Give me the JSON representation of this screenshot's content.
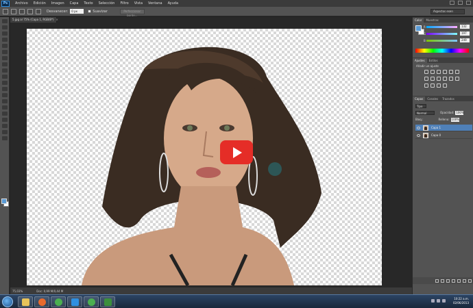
{
  "app": {
    "logo": "Ps"
  },
  "menu": [
    "Archivo",
    "Edición",
    "Imagen",
    "Capa",
    "Texto",
    "Selección",
    "Filtro",
    "Vista",
    "Ventana",
    "Ayuda"
  ],
  "options": {
    "feather_label": "Desvanecer:",
    "feather_value": "0 px",
    "antialias_label": "Suavizar",
    "refine_button": "Perfeccionar borde...",
    "workspace": "Aspectos esen"
  },
  "document": {
    "tab_title": "5.jpg al 75% (Capa 1, RGB/8*)",
    "zoom": "75,03%",
    "doc_size": "Doc: 0,99 M/0,44 M"
  },
  "panels": {
    "color": {
      "tabs": [
        "Color",
        "Muestras"
      ],
      "channels": [
        {
          "label": "R",
          "value": "132",
          "gradient": "linear-gradient(90deg,#00aaff,#ffaaff)"
        },
        {
          "label": "G",
          "value": "197",
          "gradient": "linear-gradient(90deg,#7e00ff,#7effff)"
        },
        {
          "label": "B",
          "value": "249",
          "gradient": "linear-gradient(90deg,#7ec500,#7ec5ff)"
        }
      ],
      "foreground": "#84c5f9"
    },
    "adjustments": {
      "tabs": [
        "Ajustes",
        "Estilos"
      ],
      "title": "Añadir un ajuste"
    },
    "layers": {
      "tabs": [
        "Capas",
        "Canales",
        "Trazados"
      ],
      "kind_select": "Tipo",
      "blend_mode": "Normal",
      "opacity_label": "Opacidad:",
      "opacity_value": "100%",
      "lock_label": "Bloq.:",
      "fill_label": "Relleno:",
      "fill_value": "100%",
      "items": [
        {
          "name": "Capa 1",
          "selected": true
        },
        {
          "name": "Capa 0",
          "selected": false
        }
      ]
    }
  },
  "taskbar": {
    "time": "10:22 a.m.",
    "date": "02/06/2013",
    "apps": [
      {
        "name": "explorer",
        "color": "#e8c35a"
      },
      {
        "name": "firefox",
        "color": "#e86a2c"
      },
      {
        "name": "chrome",
        "color": "#4caf50"
      },
      {
        "name": "photoshop",
        "color": "#2f8fe0"
      },
      {
        "name": "chrome-2",
        "color": "#4caf50"
      },
      {
        "name": "camtasia",
        "color": "#3c8f3c"
      }
    ]
  },
  "overlay": {
    "play_button": "youtube-play"
  }
}
